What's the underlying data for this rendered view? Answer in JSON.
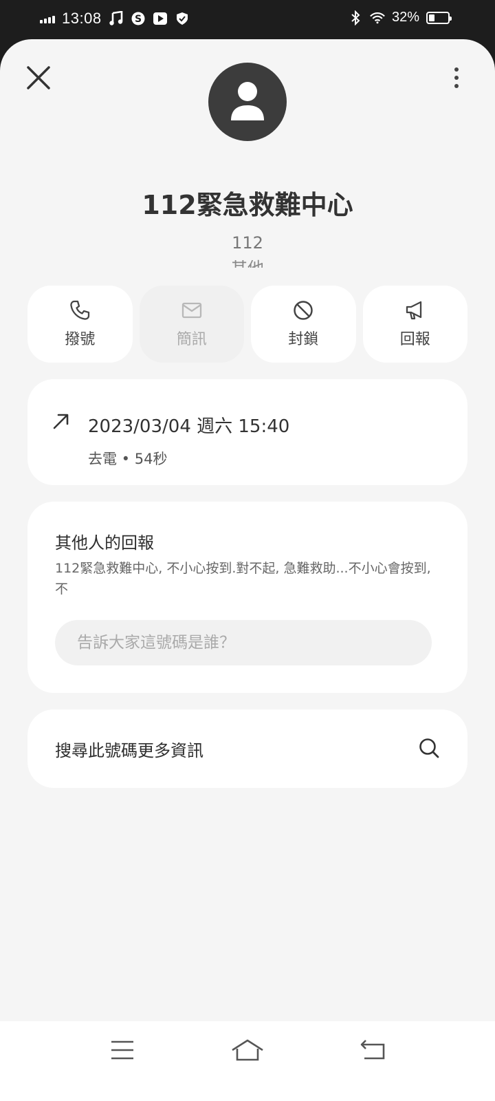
{
  "status_bar": {
    "time": "13:08",
    "battery_text": "32%",
    "battery_level": 0.32,
    "icons": [
      "signal-icon",
      "music-icon",
      "skype-icon",
      "youtube-icon",
      "shield-icon",
      "bluetooth-icon",
      "wifi-icon",
      "battery-icon"
    ]
  },
  "header": {
    "close_icon": "close-icon",
    "more_icon": "more-vertical-icon",
    "avatar_icon": "person-icon"
  },
  "contact": {
    "name": "112緊急救難中心",
    "number": "112",
    "category": "其他"
  },
  "actions": [
    {
      "label": "撥號",
      "icon": "phone-icon",
      "enabled": true
    },
    {
      "label": "簡訊",
      "icon": "message-icon",
      "enabled": false
    },
    {
      "label": "封鎖",
      "icon": "block-icon",
      "enabled": true
    },
    {
      "label": "回報",
      "icon": "megaphone-icon",
      "enabled": true
    }
  ],
  "call_log": {
    "direction_icon": "outgoing-arrow-icon",
    "datetime": "2023/03/04 週六 15:40",
    "meta": "去電 • 54秒"
  },
  "reports": {
    "title": "其他人的回報",
    "text": "112緊急救難中心, 不小心按到.對不起, 急難救助...不小心會按到, 不",
    "input_placeholder": "告訴大家這號碼是誰？"
  },
  "search": {
    "label": "搜尋此號碼更多資訊",
    "icon": "search-icon"
  },
  "nav": {
    "icons": [
      "menu-icon",
      "home-icon",
      "back-icon"
    ]
  },
  "colors": {
    "background": "#f5f5f5",
    "card": "#ffffff",
    "status_bar": "#1d1d1d",
    "avatar": "#3c3c3c",
    "text_primary": "#333333",
    "text_secondary": "#777777"
  }
}
